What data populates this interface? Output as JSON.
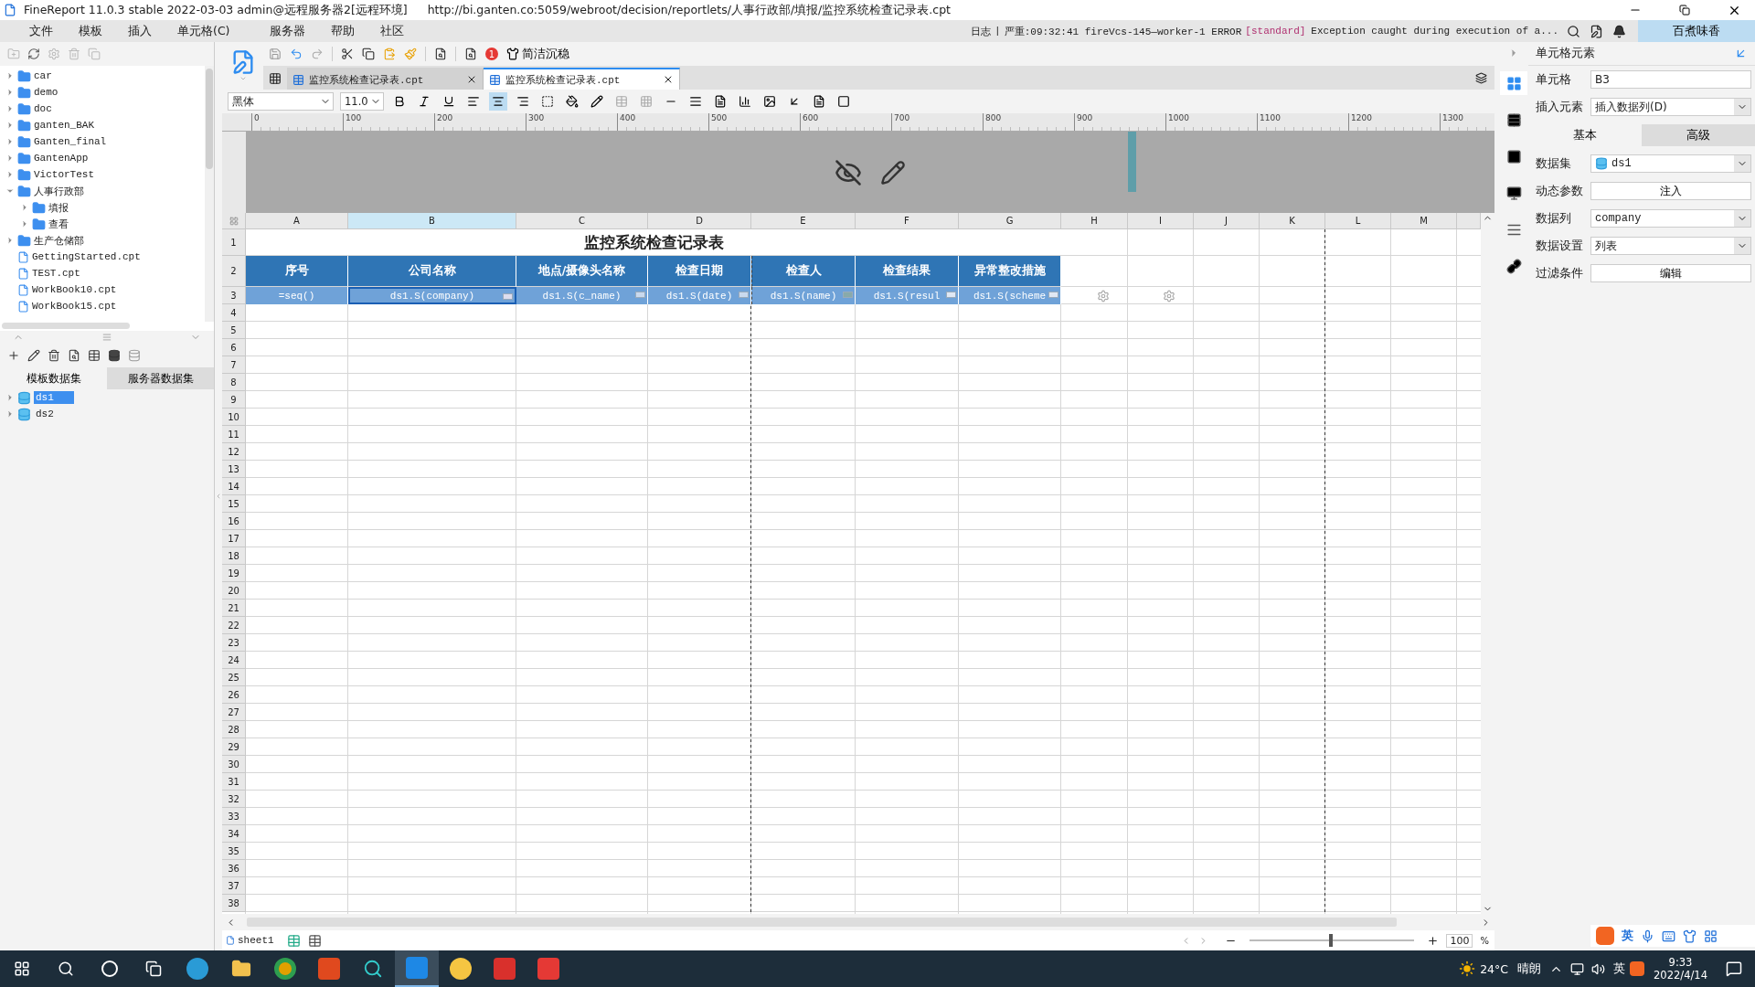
{
  "window": {
    "title": "FineReport 11.0.3 stable 2022-03-03 admin@远程服务器2[远程环境]",
    "path": "http://bi.ganten.co:5059/webroot/decision/reportlets/人事行政部/填报/监控系统检查记录表.cpt"
  },
  "menu": [
    "文件",
    "模板",
    "插入",
    "单元格(C)",
    "服务器",
    "帮助",
    "社区"
  ],
  "log": {
    "label": "日志",
    "separator": "|",
    "head": "严重:09:32:41 fireVcs-145—worker-1 ERROR",
    "tag": "[standard]",
    "message": "Exception caught during execution of a..."
  },
  "user": "百煮味香",
  "tree": [
    {
      "label": "car",
      "kind": "folder",
      "expanded": false
    },
    {
      "label": "demo",
      "kind": "folder",
      "expanded": false
    },
    {
      "label": "doc",
      "kind": "folder",
      "expanded": false
    },
    {
      "label": "ganten_BAK",
      "kind": "folder",
      "expanded": false
    },
    {
      "label": "Ganten_final",
      "kind": "folder",
      "expanded": false
    },
    {
      "label": "GantenApp",
      "kind": "folder",
      "expanded": false
    },
    {
      "label": "VictorTest",
      "kind": "folder",
      "expanded": false
    },
    {
      "label": "人事行政部",
      "kind": "folder",
      "expanded": true,
      "children": [
        {
          "label": "填报",
          "kind": "folder",
          "expanded": false
        },
        {
          "label": "查看",
          "kind": "folder",
          "expanded": false
        }
      ]
    },
    {
      "label": "生产仓储部",
      "kind": "folder",
      "expanded": false
    },
    {
      "label": "GettingStarted.cpt",
      "kind": "file"
    },
    {
      "label": "TEST.cpt",
      "kind": "file"
    },
    {
      "label": "WorkBook10.cpt",
      "kind": "file"
    },
    {
      "label": "WorkBook15.cpt",
      "kind": "file"
    }
  ],
  "dataset_tabs": [
    {
      "label": "模板数据集",
      "selected": true
    },
    {
      "label": "服务器数据集",
      "selected": false
    }
  ],
  "datasets": [
    {
      "label": "ds1",
      "selected": true
    },
    {
      "label": "ds2",
      "selected": false
    }
  ],
  "toolbar": {
    "badge": "1",
    "theme_button": "简洁沉稳"
  },
  "doc_tabs": [
    {
      "label": "监控系统检查记录表.cpt",
      "selected": false
    },
    {
      "label": "监控系统检查记录表.cpt",
      "selected": true
    }
  ],
  "format": {
    "font": "黑体",
    "size": "11.0",
    "alignment": [
      {
        "kind": "left",
        "selected": false
      },
      {
        "kind": "center",
        "selected": true
      },
      {
        "kind": "right",
        "selected": false
      }
    ]
  },
  "ruler": [
    "0",
    "100",
    "200",
    "300",
    "400",
    "500",
    "600",
    "700",
    "800",
    "900",
    "1000",
    "1100",
    "1200",
    "1300"
  ],
  "sheet": {
    "columns": [
      {
        "label": "A",
        "selected": false
      },
      {
        "label": "B",
        "selected": true
      },
      {
        "label": "C",
        "selected": false
      },
      {
        "label": "D",
        "selected": false
      },
      {
        "label": "E",
        "selected": false
      },
      {
        "label": "F",
        "selected": false
      },
      {
        "label": "G",
        "selected": false
      },
      {
        "label": "H",
        "selected": false
      },
      {
        "label": "I",
        "selected": false
      },
      {
        "label": "J",
        "selected": false
      },
      {
        "label": "K",
        "selected": false
      },
      {
        "label": "L",
        "selected": false
      },
      {
        "label": "M",
        "selected": false
      }
    ],
    "row_numbers": [
      "1",
      "2",
      "3",
      "4",
      "5",
      "6",
      "7",
      "8",
      "9",
      "10",
      "11",
      "12",
      "13",
      "14",
      "15",
      "16",
      "17",
      "18",
      "19",
      "20",
      "21",
      "22",
      "23",
      "24",
      "25",
      "26",
      "27",
      "28",
      "29",
      "30",
      "31",
      "32",
      "33",
      "34",
      "35",
      "36",
      "37",
      "38"
    ],
    "title": "监控系统检查记录表",
    "headers": [
      "序号",
      "公司名称",
      "地点/摄像头名称",
      "检查日期",
      "检查人",
      "检查结果",
      "异常整改措施"
    ],
    "formulas": [
      {
        "text": "=seq()",
        "selected": false,
        "kind": "plain"
      },
      {
        "text": "ds1.S(company)",
        "selected": true,
        "kind": "dropdown"
      },
      {
        "text": "ds1.S(c_name)",
        "selected": false,
        "kind": "field"
      },
      {
        "text": "ds1.S(date)",
        "selected": false,
        "kind": "field"
      },
      {
        "text": "ds1.S(name)",
        "selected": false,
        "kind": "grid"
      },
      {
        "text": "ds1.S(resul",
        "selected": false,
        "kind": "arrow"
      },
      {
        "text": "ds1.S(scheme",
        "selected": false,
        "kind": "arrow"
      }
    ]
  },
  "sheet_tab": "sheet1",
  "zoom": {
    "value": "100",
    "unit": "%",
    "level": 0.48
  },
  "panel": {
    "title": "单元格元素",
    "top_fields": [
      {
        "label": "单元格",
        "kind": "input",
        "value": "B3"
      },
      {
        "label": "插入元素",
        "kind": "select",
        "value": "插入数据列(D)"
      }
    ],
    "tabs": [
      {
        "label": "基本",
        "selected": true
      },
      {
        "label": "高级",
        "selected": false
      }
    ],
    "fields": [
      {
        "label": "数据集",
        "kind": "dataset",
        "value": "ds1"
      },
      {
        "label": "动态参数",
        "kind": "button",
        "value": "注入"
      },
      {
        "label": "数据列",
        "kind": "select",
        "value": "company"
      },
      {
        "label": "数据设置",
        "kind": "select",
        "value": "列表"
      },
      {
        "label": "过滤条件",
        "kind": "button",
        "value": "编辑"
      }
    ]
  },
  "ime": "英",
  "tray": {
    "temperature": "24°C",
    "weather": "晴朗",
    "ime": "英",
    "time": "9:33",
    "date": "2022/4/14"
  }
}
